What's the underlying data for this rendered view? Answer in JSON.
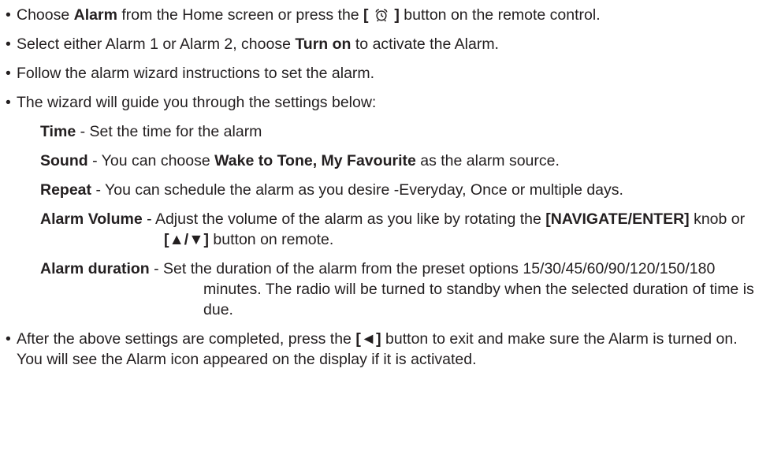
{
  "bullets": {
    "b1": {
      "t1": "Choose ",
      "alarm": "Alarm",
      "t2": " from the Home screen or press the ",
      "btn_open": "[",
      "btn_close": "]",
      "t3": " button on the remote control."
    },
    "b2": {
      "t1": "Select either Alarm 1 or Alarm 2, choose ",
      "turn_on": "Turn on",
      "t2": " to activate the Alarm."
    },
    "b3": {
      "t1": "Follow the alarm wizard instructions to set the alarm."
    },
    "b4": {
      "t1": "The wizard will guide you through the settings below:"
    },
    "b5": {
      "t1": "After the above settings are completed, press the ",
      "btn": "[◄]",
      "t2": " button to exit and make sure the Alarm is turned on. You will see the Alarm icon appeared on the display if it is activated."
    }
  },
  "settings": {
    "time": {
      "label": "Time",
      "text": " - Set the time for the alarm"
    },
    "sound": {
      "label": "Sound",
      "t1": " - You can choose ",
      "bold": "Wake to Tone, My Favourite",
      "t2": " as the alarm source."
    },
    "repeat": {
      "label": "Repeat",
      "text": " - You can schedule the alarm as you desire -Everyday, Once or multiple days."
    },
    "volume": {
      "label": "Alarm Volume",
      "t1": " - Adjust the volume of the alarm as you like by rotating the ",
      "knob": "[NAVIGATE/ENTER]",
      "t2": " knob or ",
      "btn": "[▲/▼]",
      "t3": " button on remote."
    },
    "duration": {
      "label": "Alarm duration",
      "text": " - Set the duration of the alarm from the preset options 15/30/45/60/90/120/150/180 minutes. The radio will be turned to standby when the selected duration of time is due."
    }
  },
  "icons": {
    "alarm_clock": "alarm-clock-icon",
    "bullet": "•"
  }
}
